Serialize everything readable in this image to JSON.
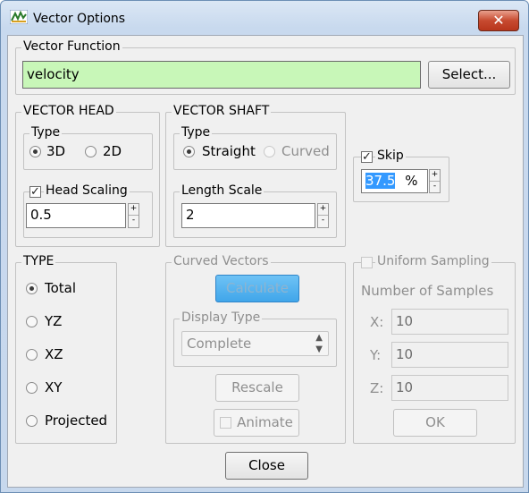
{
  "window": {
    "title": "Vector Options",
    "close_glyph": "✕"
  },
  "vector_function": {
    "legend": "Vector Function",
    "value": "velocity",
    "select_label": "Select..."
  },
  "vector_head": {
    "legend": "VECTOR HEAD",
    "type_legend": "Type",
    "opt_3d": "3D",
    "opt_2d": "2D",
    "head_scaling_label": "Head Scaling",
    "head_scaling_value": "0.5",
    "selected": "3D",
    "head_scaling_checked": true
  },
  "vector_shaft": {
    "legend": "VECTOR SHAFT",
    "type_legend": "Type",
    "opt_straight": "Straight",
    "opt_curved": "Curved",
    "selected": "Straight",
    "length_scale_label": "Length Scale",
    "length_scale_value": "2"
  },
  "skip": {
    "label": "Skip",
    "checked": true,
    "value": "37.5",
    "unit": "%"
  },
  "type_group": {
    "legend": "TYPE",
    "options": [
      "Total",
      "YZ",
      "XZ",
      "XY",
      "Projected"
    ],
    "selected": "Total"
  },
  "curved_vectors": {
    "legend": "Curved Vectors",
    "calculate_label": "Calculate",
    "display_type_legend": "Display Type",
    "display_type_value": "Complete",
    "rescale_label": "Rescale",
    "animate_label": "Animate"
  },
  "uniform_sampling": {
    "label": "Uniform Sampling",
    "samples_label": "Number of Samples",
    "x_label": "X:",
    "x_value": "10",
    "y_label": "Y:",
    "y_value": "10",
    "z_label": "Z:",
    "z_value": "10",
    "ok_label": "OK"
  },
  "footer": {
    "close_label": "Close"
  },
  "colors": {
    "function_field_bg": "#c8f7b8",
    "calculate_button": "#40a6ea",
    "selection": "#3399ff"
  },
  "icons": {
    "app": "vector-app-icon",
    "close": "close-icon",
    "spin": "spin-up-down-icon",
    "dropdown": "dropdown-arrows-icon",
    "checkmark": "checkmark-icon"
  }
}
